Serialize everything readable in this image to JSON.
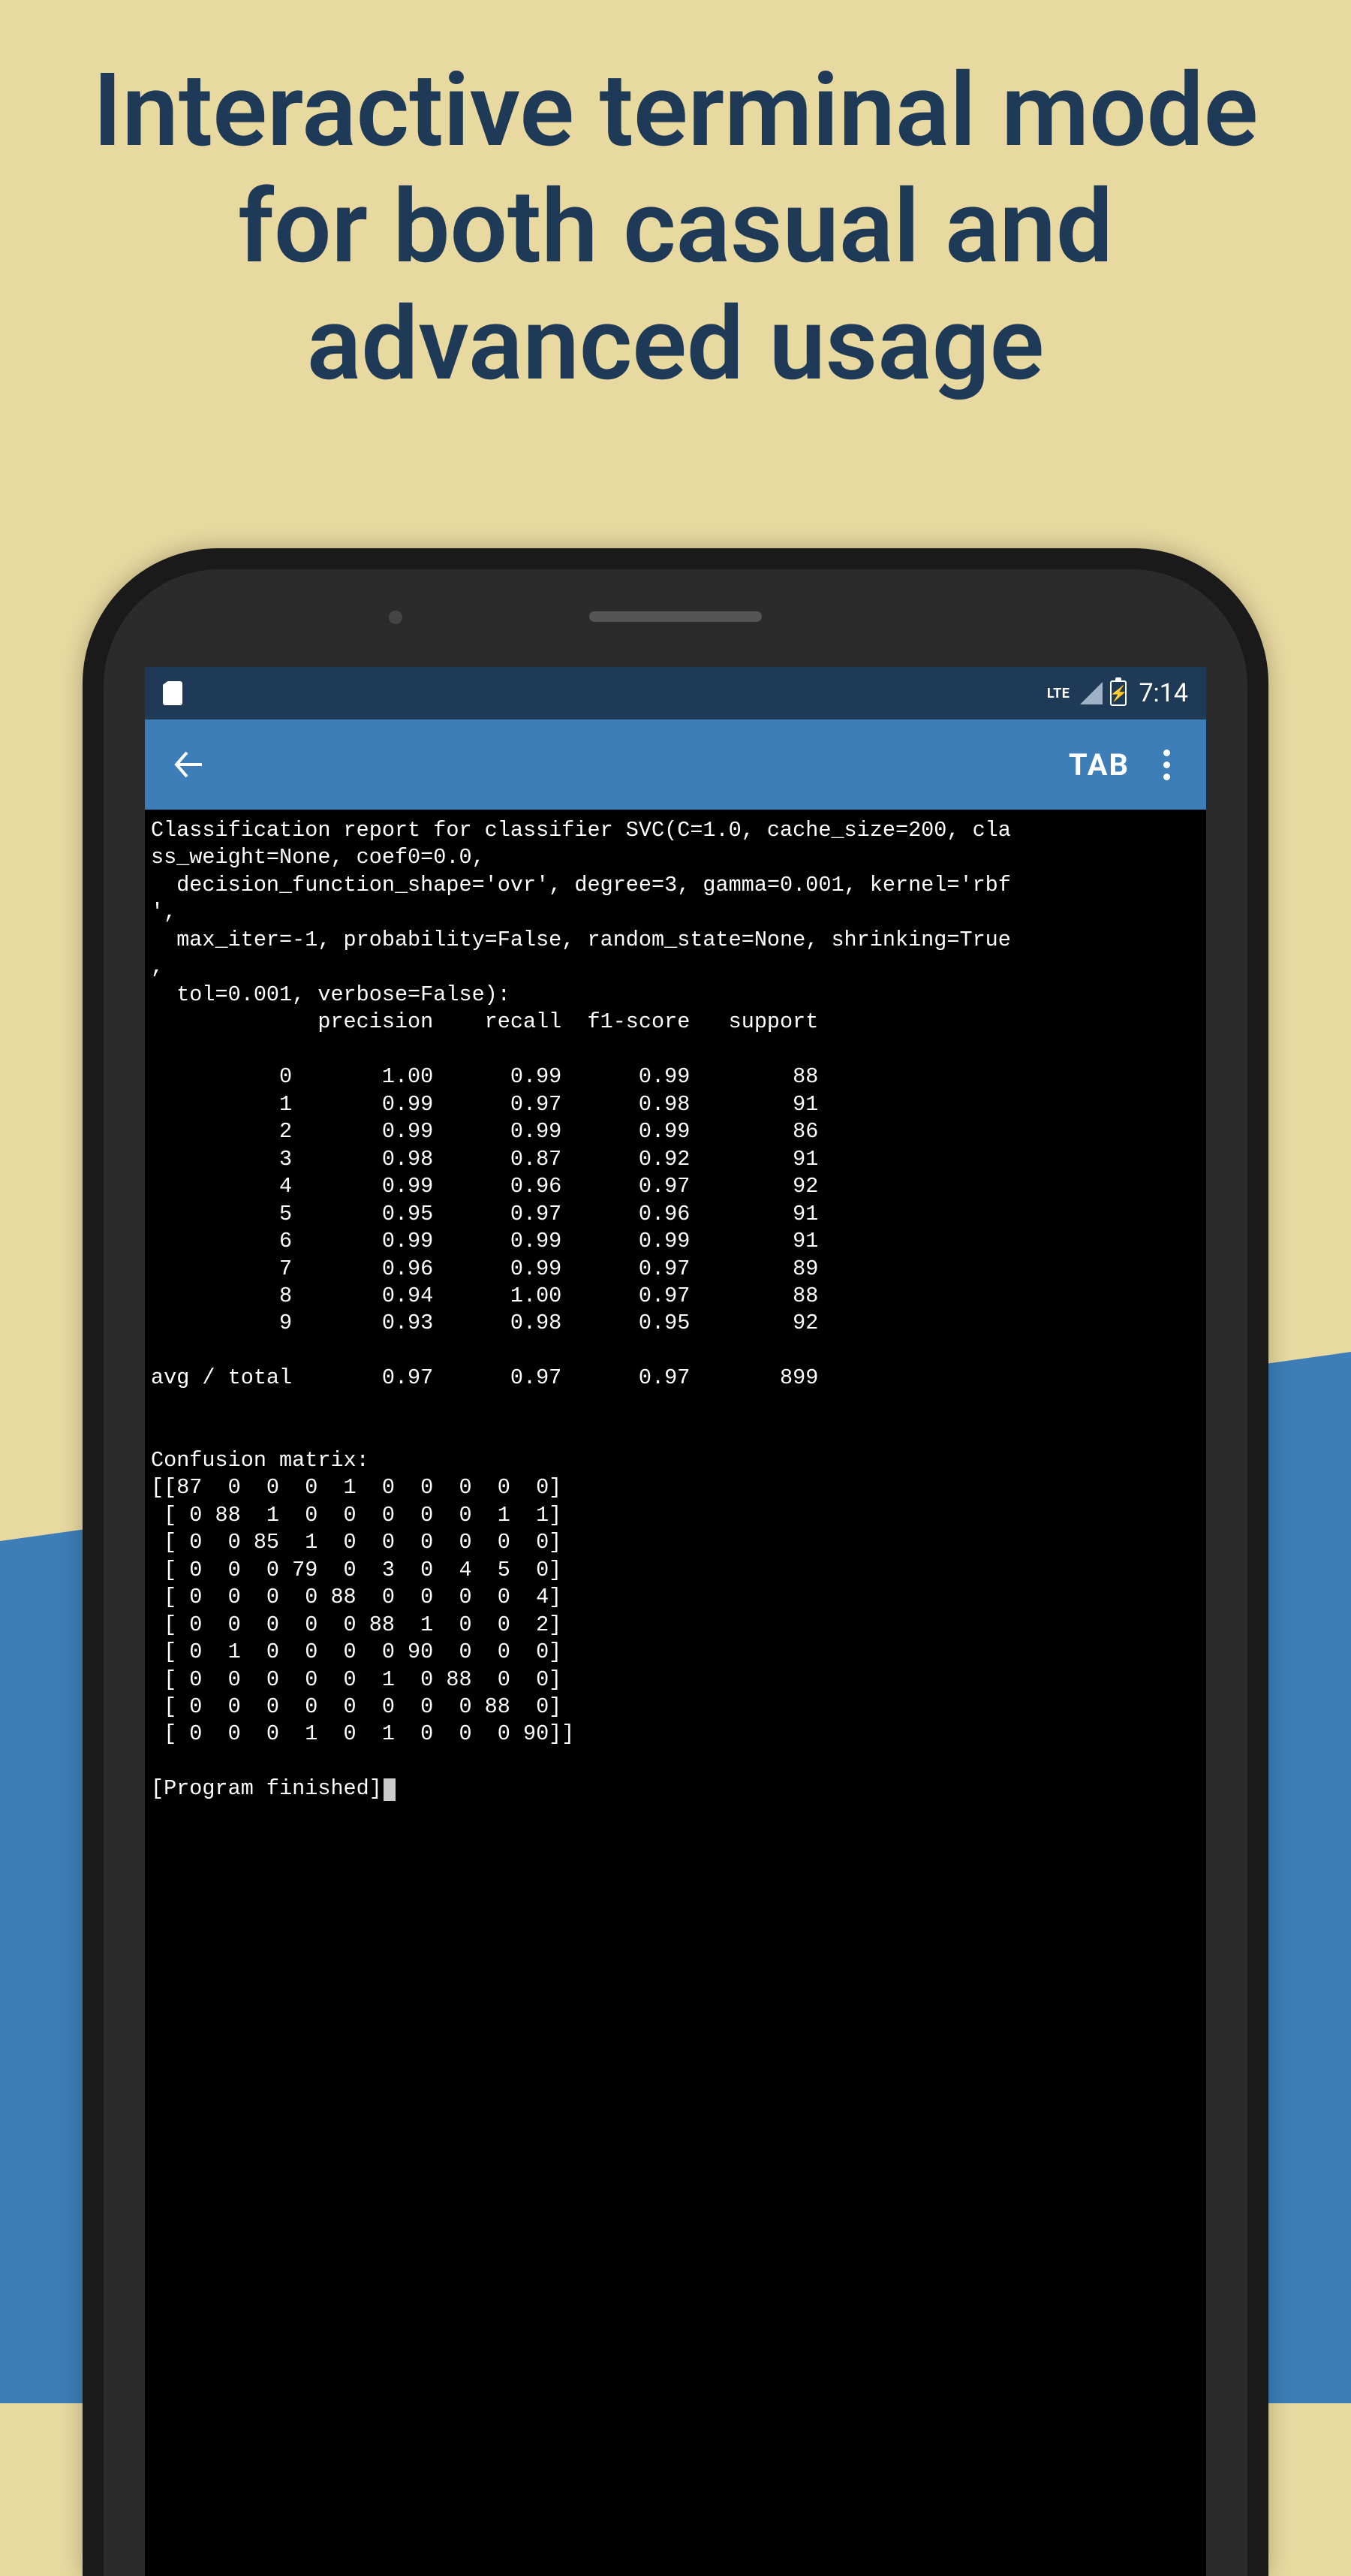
{
  "promo": {
    "headline": "Interactive terminal mode for both casual and advanced usage"
  },
  "status_bar": {
    "network_label": "LTE",
    "time": "7:14"
  },
  "app_bar": {
    "tab_label": "TAB"
  },
  "terminal": {
    "header_lines": [
      "Classification report for classifier SVC(C=1.0, cache_size=200, cla",
      "ss_weight=None, coef0=0.0,",
      "  decision_function_shape='ovr', degree=3, gamma=0.001, kernel='rbf",
      "',",
      "  max_iter=-1, probability=False, random_state=None, shrinking=True",
      ",",
      "  tol=0.001, verbose=False):"
    ],
    "report_header": "             precision    recall  f1-score   support",
    "report_rows": [
      {
        "label": "0",
        "precision": "1.00",
        "recall": "0.99",
        "f1": "0.99",
        "support": "88"
      },
      {
        "label": "1",
        "precision": "0.99",
        "recall": "0.97",
        "f1": "0.98",
        "support": "91"
      },
      {
        "label": "2",
        "precision": "0.99",
        "recall": "0.99",
        "f1": "0.99",
        "support": "86"
      },
      {
        "label": "3",
        "precision": "0.98",
        "recall": "0.87",
        "f1": "0.92",
        "support": "91"
      },
      {
        "label": "4",
        "precision": "0.99",
        "recall": "0.96",
        "f1": "0.97",
        "support": "92"
      },
      {
        "label": "5",
        "precision": "0.95",
        "recall": "0.97",
        "f1": "0.96",
        "support": "91"
      },
      {
        "label": "6",
        "precision": "0.99",
        "recall": "0.99",
        "f1": "0.99",
        "support": "91"
      },
      {
        "label": "7",
        "precision": "0.96",
        "recall": "0.99",
        "f1": "0.97",
        "support": "89"
      },
      {
        "label": "8",
        "precision": "0.94",
        "recall": "1.00",
        "f1": "0.97",
        "support": "88"
      },
      {
        "label": "9",
        "precision": "0.93",
        "recall": "0.98",
        "f1": "0.95",
        "support": "92"
      }
    ],
    "report_total": {
      "label": "avg / total",
      "precision": "0.97",
      "recall": "0.97",
      "f1": "0.97",
      "support": "899"
    },
    "confusion_label": "Confusion matrix:",
    "confusion_matrix": [
      [
        87,
        0,
        0,
        0,
        1,
        0,
        0,
        0,
        0,
        0
      ],
      [
        0,
        88,
        1,
        0,
        0,
        0,
        0,
        0,
        1,
        1
      ],
      [
        0,
        0,
        85,
        1,
        0,
        0,
        0,
        0,
        0,
        0
      ],
      [
        0,
        0,
        0,
        79,
        0,
        3,
        0,
        4,
        5,
        0
      ],
      [
        0,
        0,
        0,
        0,
        88,
        0,
        0,
        0,
        0,
        4
      ],
      [
        0,
        0,
        0,
        0,
        0,
        88,
        1,
        0,
        0,
        2
      ],
      [
        0,
        1,
        0,
        0,
        0,
        0,
        90,
        0,
        0,
        0
      ],
      [
        0,
        0,
        0,
        0,
        0,
        1,
        0,
        88,
        0,
        0
      ],
      [
        0,
        0,
        0,
        0,
        0,
        0,
        0,
        0,
        88,
        0
      ],
      [
        0,
        0,
        0,
        1,
        0,
        1,
        0,
        0,
        0,
        90
      ]
    ],
    "finished_label": "[Program finished]"
  }
}
